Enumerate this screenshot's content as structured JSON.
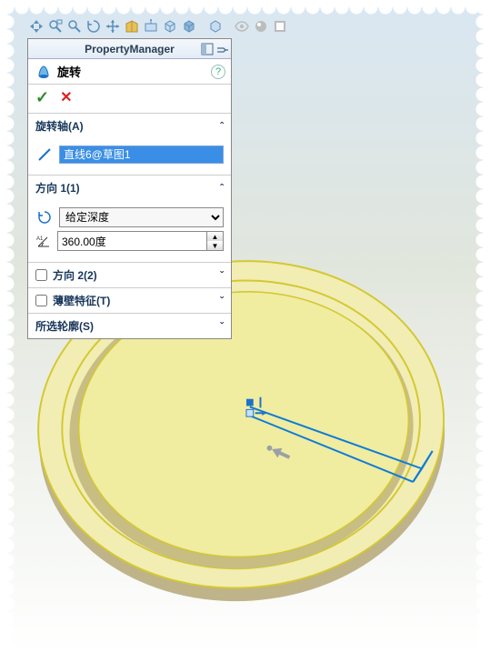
{
  "panel": {
    "title": "PropertyManager",
    "feature_name": "旋转",
    "sections": {
      "axis": {
        "label": "旋转轴(A)",
        "value": "直线6@草图1"
      },
      "dir1": {
        "label": "方向 1(1)",
        "type_options": [
          "给定深度"
        ],
        "type_selected": "给定深度",
        "angle": "360.00度"
      },
      "dir2": {
        "label": "方向 2(2)",
        "checked": false
      },
      "thin": {
        "label": "薄壁特征(T)",
        "checked": false
      },
      "contour": {
        "label": "所选轮廓(S)"
      }
    }
  },
  "chevrons": {
    "open": "ˆ",
    "closed": "ˇ"
  },
  "colors": {
    "preview_body": "#f0eca0",
    "preview_edge": "#d5c92e",
    "sketch_line": "#0d7bd8"
  }
}
